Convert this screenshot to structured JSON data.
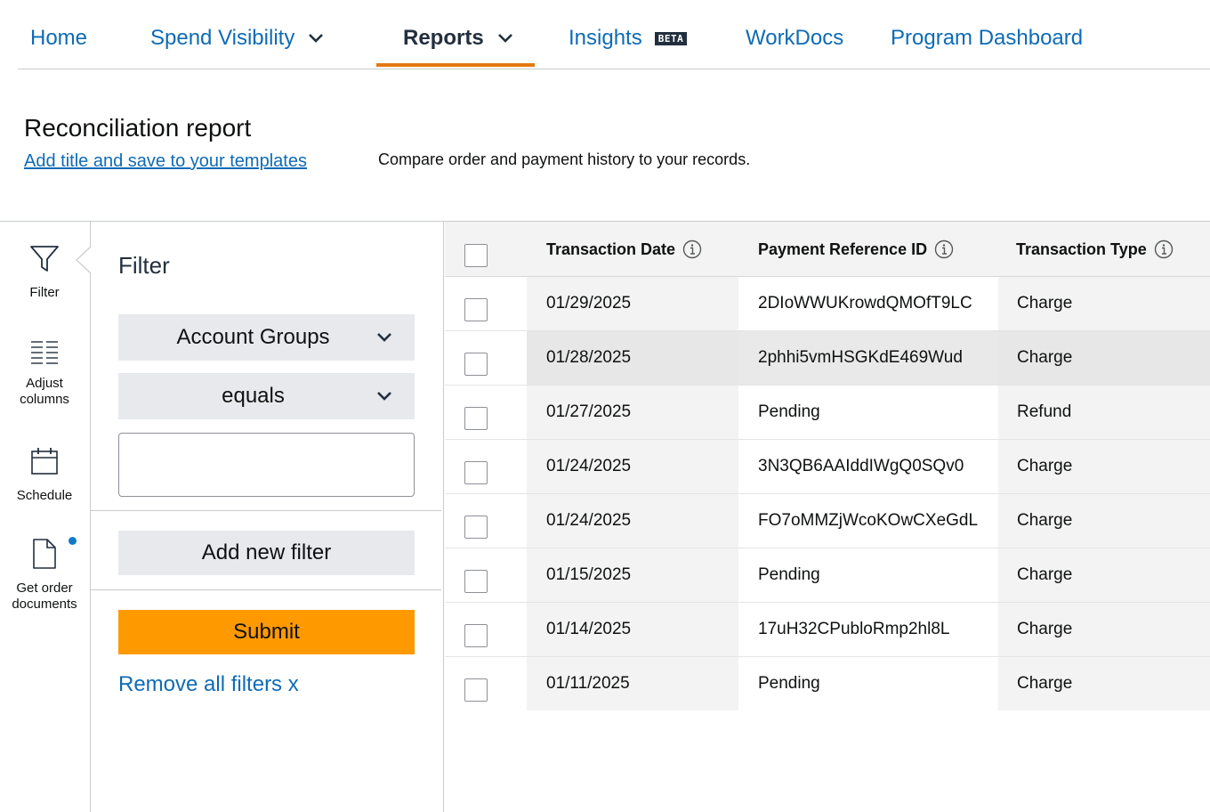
{
  "nav": {
    "items": [
      {
        "label": "Home",
        "dropdown": false,
        "active": false
      },
      {
        "label": "Spend Visibility",
        "dropdown": true,
        "active": false
      },
      {
        "label": "Reports",
        "dropdown": true,
        "active": true
      },
      {
        "label": "Insights",
        "badge": "BETA",
        "dropdown": false,
        "active": false
      },
      {
        "label": "WorkDocs",
        "dropdown": false,
        "active": false
      },
      {
        "label": "Program Dashboard",
        "dropdown": false,
        "active": false
      }
    ],
    "active_underline_color": "#e47911"
  },
  "page": {
    "title": "Reconciliation report",
    "template_link": "Add title and save to your templates",
    "description": "Compare order and payment history to your records."
  },
  "rail": {
    "items": [
      {
        "label": "Filter",
        "icon": "filter-icon"
      },
      {
        "label": "Adjust\ncolumns",
        "icon": "columns-icon"
      },
      {
        "label": "Schedule",
        "icon": "calendar-icon"
      },
      {
        "label": "Get order\ndocuments",
        "icon": "document-icon",
        "notification_dot": true
      }
    ]
  },
  "filter": {
    "title": "Filter",
    "field_select": "Account Groups",
    "operator_select": "equals",
    "value_input": "",
    "add_filter_label": "Add new filter",
    "submit_label": "Submit",
    "remove_all_label": "Remove all filters x"
  },
  "table": {
    "columns": [
      "Transaction Date",
      "Payment Reference ID",
      "Transaction Type"
    ],
    "rows": [
      {
        "date": "01/29/2025",
        "payment_ref": "2DIoWWUKrowdQMOfT9LC",
        "type": "Charge"
      },
      {
        "date": "01/28/2025",
        "payment_ref": "2phhi5vmHSGKdE469Wud",
        "type": "Charge"
      },
      {
        "date": "01/27/2025",
        "payment_ref": "Pending",
        "type": "Refund"
      },
      {
        "date": "01/24/2025",
        "payment_ref": "3N3QB6AAIddIWgQ0SQv0",
        "type": "Charge"
      },
      {
        "date": "01/24/2025",
        "payment_ref": "FO7oMMZjWcoKOwCXeGdL",
        "type": "Charge"
      },
      {
        "date": "01/15/2025",
        "payment_ref": "Pending",
        "type": "Charge"
      },
      {
        "date": "01/14/2025",
        "payment_ref": "17uH32CPubloRmp2hl8L",
        "type": "Charge"
      },
      {
        "date": "01/11/2025",
        "payment_ref": "Pending",
        "type": "Charge"
      }
    ]
  },
  "colors": {
    "link": "#0f6bb5",
    "submit": "#ff9900",
    "button_gray": "#e7e9ec",
    "notification_dot": "#0f7bc6"
  }
}
